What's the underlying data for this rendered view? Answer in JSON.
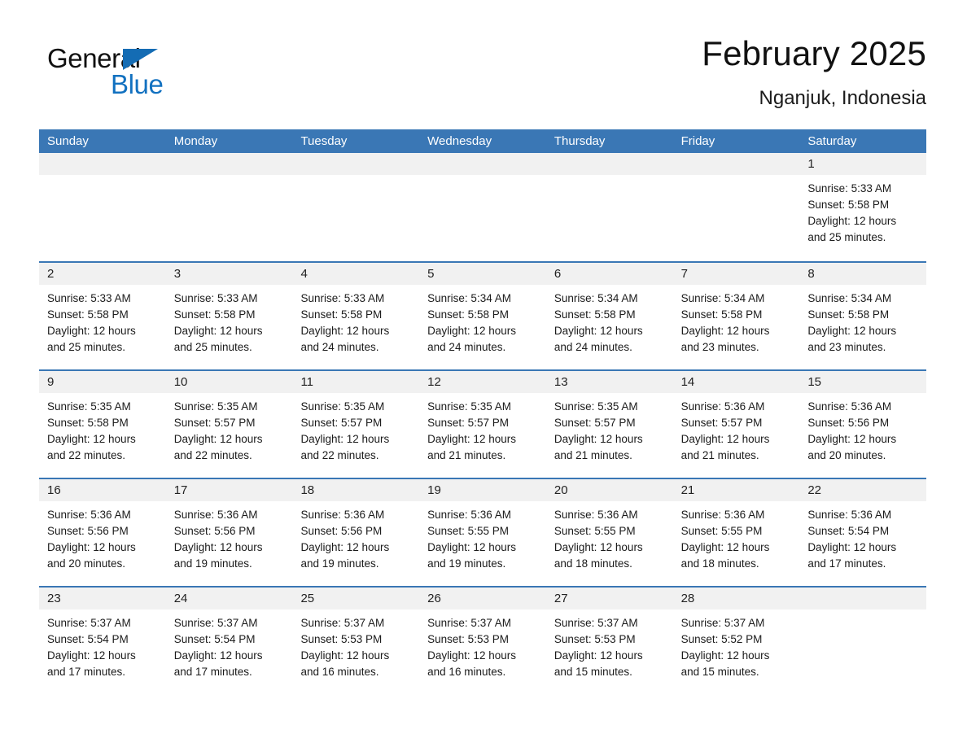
{
  "brand": {
    "word1": "General",
    "word2": "Blue",
    "flag_color": "#146cb4",
    "word2_color": "#1271c0"
  },
  "header": {
    "title": "February 2025",
    "subtitle": "Nganjuk, Indonesia"
  },
  "theme": {
    "header_blue": "#3a77b5",
    "row_rule": "#3a77b5",
    "daynum_bg": "#f1f1f1",
    "text": "#1b1b1b"
  },
  "weekdays": [
    "Sunday",
    "Monday",
    "Tuesday",
    "Wednesday",
    "Thursday",
    "Friday",
    "Saturday"
  ],
  "labels": {
    "sunrise_prefix": "Sunrise:",
    "sunset_prefix": "Sunset:",
    "daylight_prefix": "Daylight:"
  },
  "weeks": [
    [
      {
        "day": "",
        "sunrise": "",
        "sunset": "",
        "daylight1": "",
        "daylight2": ""
      },
      {
        "day": "",
        "sunrise": "",
        "sunset": "",
        "daylight1": "",
        "daylight2": ""
      },
      {
        "day": "",
        "sunrise": "",
        "sunset": "",
        "daylight1": "",
        "daylight2": ""
      },
      {
        "day": "",
        "sunrise": "",
        "sunset": "",
        "daylight1": "",
        "daylight2": ""
      },
      {
        "day": "",
        "sunrise": "",
        "sunset": "",
        "daylight1": "",
        "daylight2": ""
      },
      {
        "day": "",
        "sunrise": "",
        "sunset": "",
        "daylight1": "",
        "daylight2": ""
      },
      {
        "day": "1",
        "sunrise": "Sunrise: 5:33 AM",
        "sunset": "Sunset: 5:58 PM",
        "daylight1": "Daylight: 12 hours",
        "daylight2": "and 25 minutes."
      }
    ],
    [
      {
        "day": "2",
        "sunrise": "Sunrise: 5:33 AM",
        "sunset": "Sunset: 5:58 PM",
        "daylight1": "Daylight: 12 hours",
        "daylight2": "and 25 minutes."
      },
      {
        "day": "3",
        "sunrise": "Sunrise: 5:33 AM",
        "sunset": "Sunset: 5:58 PM",
        "daylight1": "Daylight: 12 hours",
        "daylight2": "and 25 minutes."
      },
      {
        "day": "4",
        "sunrise": "Sunrise: 5:33 AM",
        "sunset": "Sunset: 5:58 PM",
        "daylight1": "Daylight: 12 hours",
        "daylight2": "and 24 minutes."
      },
      {
        "day": "5",
        "sunrise": "Sunrise: 5:34 AM",
        "sunset": "Sunset: 5:58 PM",
        "daylight1": "Daylight: 12 hours",
        "daylight2": "and 24 minutes."
      },
      {
        "day": "6",
        "sunrise": "Sunrise: 5:34 AM",
        "sunset": "Sunset: 5:58 PM",
        "daylight1": "Daylight: 12 hours",
        "daylight2": "and 24 minutes."
      },
      {
        "day": "7",
        "sunrise": "Sunrise: 5:34 AM",
        "sunset": "Sunset: 5:58 PM",
        "daylight1": "Daylight: 12 hours",
        "daylight2": "and 23 minutes."
      },
      {
        "day": "8",
        "sunrise": "Sunrise: 5:34 AM",
        "sunset": "Sunset: 5:58 PM",
        "daylight1": "Daylight: 12 hours",
        "daylight2": "and 23 minutes."
      }
    ],
    [
      {
        "day": "9",
        "sunrise": "Sunrise: 5:35 AM",
        "sunset": "Sunset: 5:58 PM",
        "daylight1": "Daylight: 12 hours",
        "daylight2": "and 22 minutes."
      },
      {
        "day": "10",
        "sunrise": "Sunrise: 5:35 AM",
        "sunset": "Sunset: 5:57 PM",
        "daylight1": "Daylight: 12 hours",
        "daylight2": "and 22 minutes."
      },
      {
        "day": "11",
        "sunrise": "Sunrise: 5:35 AM",
        "sunset": "Sunset: 5:57 PM",
        "daylight1": "Daylight: 12 hours",
        "daylight2": "and 22 minutes."
      },
      {
        "day": "12",
        "sunrise": "Sunrise: 5:35 AM",
        "sunset": "Sunset: 5:57 PM",
        "daylight1": "Daylight: 12 hours",
        "daylight2": "and 21 minutes."
      },
      {
        "day": "13",
        "sunrise": "Sunrise: 5:35 AM",
        "sunset": "Sunset: 5:57 PM",
        "daylight1": "Daylight: 12 hours",
        "daylight2": "and 21 minutes."
      },
      {
        "day": "14",
        "sunrise": "Sunrise: 5:36 AM",
        "sunset": "Sunset: 5:57 PM",
        "daylight1": "Daylight: 12 hours",
        "daylight2": "and 21 minutes."
      },
      {
        "day": "15",
        "sunrise": "Sunrise: 5:36 AM",
        "sunset": "Sunset: 5:56 PM",
        "daylight1": "Daylight: 12 hours",
        "daylight2": "and 20 minutes."
      }
    ],
    [
      {
        "day": "16",
        "sunrise": "Sunrise: 5:36 AM",
        "sunset": "Sunset: 5:56 PM",
        "daylight1": "Daylight: 12 hours",
        "daylight2": "and 20 minutes."
      },
      {
        "day": "17",
        "sunrise": "Sunrise: 5:36 AM",
        "sunset": "Sunset: 5:56 PM",
        "daylight1": "Daylight: 12 hours",
        "daylight2": "and 19 minutes."
      },
      {
        "day": "18",
        "sunrise": "Sunrise: 5:36 AM",
        "sunset": "Sunset: 5:56 PM",
        "daylight1": "Daylight: 12 hours",
        "daylight2": "and 19 minutes."
      },
      {
        "day": "19",
        "sunrise": "Sunrise: 5:36 AM",
        "sunset": "Sunset: 5:55 PM",
        "daylight1": "Daylight: 12 hours",
        "daylight2": "and 19 minutes."
      },
      {
        "day": "20",
        "sunrise": "Sunrise: 5:36 AM",
        "sunset": "Sunset: 5:55 PM",
        "daylight1": "Daylight: 12 hours",
        "daylight2": "and 18 minutes."
      },
      {
        "day": "21",
        "sunrise": "Sunrise: 5:36 AM",
        "sunset": "Sunset: 5:55 PM",
        "daylight1": "Daylight: 12 hours",
        "daylight2": "and 18 minutes."
      },
      {
        "day": "22",
        "sunrise": "Sunrise: 5:36 AM",
        "sunset": "Sunset: 5:54 PM",
        "daylight1": "Daylight: 12 hours",
        "daylight2": "and 17 minutes."
      }
    ],
    [
      {
        "day": "23",
        "sunrise": "Sunrise: 5:37 AM",
        "sunset": "Sunset: 5:54 PM",
        "daylight1": "Daylight: 12 hours",
        "daylight2": "and 17 minutes."
      },
      {
        "day": "24",
        "sunrise": "Sunrise: 5:37 AM",
        "sunset": "Sunset: 5:54 PM",
        "daylight1": "Daylight: 12 hours",
        "daylight2": "and 17 minutes."
      },
      {
        "day": "25",
        "sunrise": "Sunrise: 5:37 AM",
        "sunset": "Sunset: 5:53 PM",
        "daylight1": "Daylight: 12 hours",
        "daylight2": "and 16 minutes."
      },
      {
        "day": "26",
        "sunrise": "Sunrise: 5:37 AM",
        "sunset": "Sunset: 5:53 PM",
        "daylight1": "Daylight: 12 hours",
        "daylight2": "and 16 minutes."
      },
      {
        "day": "27",
        "sunrise": "Sunrise: 5:37 AM",
        "sunset": "Sunset: 5:53 PM",
        "daylight1": "Daylight: 12 hours",
        "daylight2": "and 15 minutes."
      },
      {
        "day": "28",
        "sunrise": "Sunrise: 5:37 AM",
        "sunset": "Sunset: 5:52 PM",
        "daylight1": "Daylight: 12 hours",
        "daylight2": "and 15 minutes."
      },
      {
        "day": "",
        "sunrise": "",
        "sunset": "",
        "daylight1": "",
        "daylight2": ""
      }
    ]
  ]
}
